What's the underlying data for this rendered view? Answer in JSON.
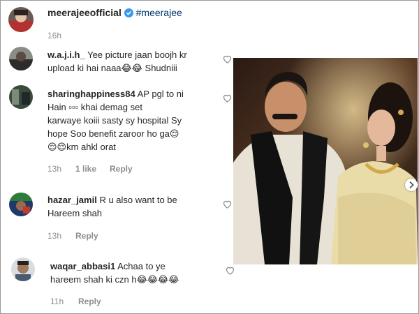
{
  "post": {
    "username": "meerajeeofficial",
    "hashtag": "#meerajee",
    "time": "16h"
  },
  "comments": [
    {
      "username": "w.a.j.i.h_",
      "line1": "Yee picture jaan boojh kr",
      "line2": "upload ki hai naaa😂😂 Shudniii"
    },
    {
      "username": "sharinghappiness84",
      "line1": "AP pgl to ni",
      "line2": "Hain ▫▫▫ khai demag set",
      "line3": "karwaye koiii sasty sy hospital Sy",
      "line4": "hope Soo benefit zaroor ho ga😌",
      "line5": "😌😌km ahkl orat",
      "time": "13h",
      "likes": "1 like",
      "reply": "Reply"
    },
    {
      "username": "hazar_jamil",
      "line1": "R u also want to be",
      "line2": "Hareem shah",
      "time": "13h",
      "reply": "Reply"
    },
    {
      "username": "waqar_abbasi1",
      "line1": "Achaa to ye",
      "line2": "hareem shah ki czn h😂😂😂😂",
      "time": "11h",
      "reply": "Reply"
    }
  ],
  "icons": {
    "verified": "verified-badge-icon",
    "like": "heart-outline-icon",
    "carousel": "chevron-right-icon"
  },
  "colors": {
    "verified_blue": "#3897f0",
    "hashtag": "#00376b",
    "meta_gray": "#8e8e8e"
  }
}
